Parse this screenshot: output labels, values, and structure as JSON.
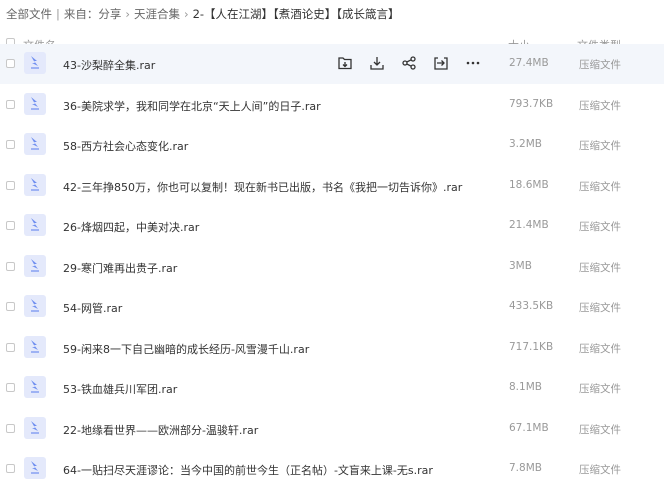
{
  "breadcrumb": {
    "items": [
      "全部文件",
      "来自：分享",
      "天涯合集"
    ],
    "current": "2-【人在江湖】【煮酒论史】【成长箴言】"
  },
  "header": {
    "name": "文件名",
    "size": "大小",
    "type": "文件类型"
  },
  "files": [
    {
      "name": "43-沙梨醉全集.rar",
      "size": "27.4MB",
      "type": "压缩文件"
    },
    {
      "name": "36-美院求学，我和同学在北京“天上人间”的日子.rar",
      "size": "793.7KB",
      "type": "压缩文件"
    },
    {
      "name": "58-西方社会心态变化.rar",
      "size": "3.2MB",
      "type": "压缩文件"
    },
    {
      "name": "42-三年挣850万，你也可以复制！现在新书已出版，书名《我把一切告诉你》.rar",
      "size": "18.6MB",
      "type": "压缩文件"
    },
    {
      "name": "26-烽烟四起，中美对决.rar",
      "size": "21.4MB",
      "type": "压缩文件"
    },
    {
      "name": "29-寒门难再出贵子.rar",
      "size": "3MB",
      "type": "压缩文件"
    },
    {
      "name": "54-网管.rar",
      "size": "433.5KB",
      "type": "压缩文件"
    },
    {
      "name": "59-闲来8一下自己幽暗的成长经历-风雪漫千山.rar",
      "size": "717.1KB",
      "type": "压缩文件"
    },
    {
      "name": "53-铁血雄兵川军团.rar",
      "size": "8.1MB",
      "type": "压缩文件"
    },
    {
      "name": "22-地缘看世界——欧洲部分-温骏轩.rar",
      "size": "67.1MB",
      "type": "压缩文件"
    },
    {
      "name": "64-一贴扫尽天涯谬论：当今中国的前世今生（正名帖）-文盲来上课-无s.rar",
      "size": "7.8MB",
      "type": "压缩文件"
    }
  ],
  "row_actions": [
    "save-icon",
    "download-icon",
    "share-icon",
    "move-icon",
    "more-icon"
  ],
  "colors": {
    "accent": "#6f8ef0",
    "icon_bg": "#e4e9fb",
    "hover_bg": "#f3f6fb"
  }
}
